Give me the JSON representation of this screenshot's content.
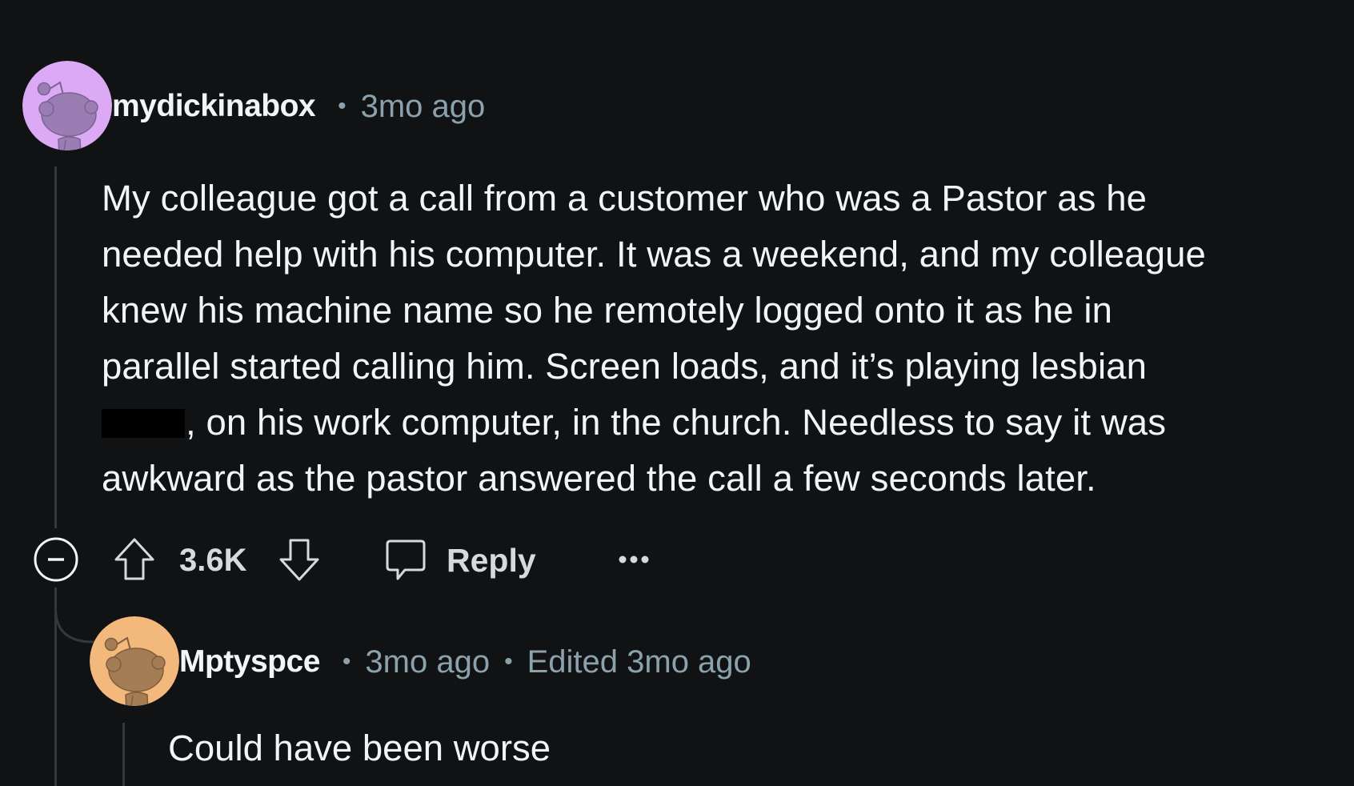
{
  "comments": [
    {
      "username": "mydickinabox",
      "timestamp": "3mo ago",
      "avatar": {
        "icon": "snoo-avatar-icon",
        "bg_color": "#dcaaf5",
        "fg_color": "#9a7db3"
      },
      "body_lines": [
        "My colleague got a call from a customer who was a Pastor as he",
        "needed help with his computer. It was a weekend, and my colleague",
        "knew his machine name so he remotely logged onto it as he in",
        "parallel started calling him. Screen loads, and it’s playing lesbian",
        ", on his work computer, in the church. Needless to say it was",
        "awkward as the pastor answered the call a few seconds later."
      ],
      "redacted_word_present": true,
      "actions": {
        "collapse_icon": "collapse-minus-icon",
        "upvote_icon": "upvote-arrow-icon",
        "vote_count": "3.6K",
        "downvote_icon": "downvote-arrow-icon",
        "reply_icon": "comment-bubble-icon",
        "reply_label": "Reply",
        "more_icon": "ellipsis-icon",
        "more_label": "•••"
      }
    },
    {
      "username": "Mptyspce",
      "timestamp": "3mo ago",
      "edited": "Edited 3mo ago",
      "avatar": {
        "icon": "snoo-avatar-icon",
        "bg_color": "#f3b87c",
        "fg_color": "#a57d55"
      },
      "body": "Could have been worse"
    }
  ],
  "separator": "•",
  "colors": {
    "background": "#101214",
    "text_primary": "#f2f4f5",
    "text_meta": "#8ba2ad",
    "thread_line": "#33383c",
    "action_text": "#d7dadc"
  }
}
